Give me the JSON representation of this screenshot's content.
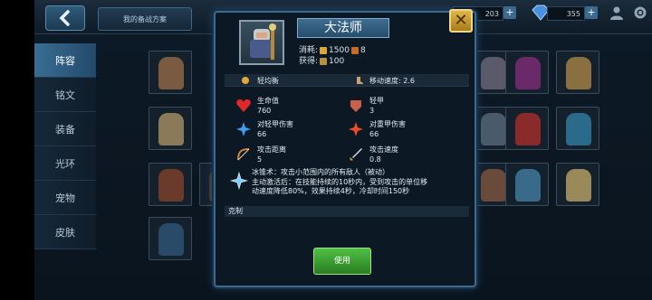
{
  "topbar": {
    "plan_label": "我的备战方案",
    "gold_value": "203",
    "gem_value": "355",
    "back_icon": "chevron-left-icon",
    "user_icon": "user-icon",
    "settings_icon": "gear-icon"
  },
  "tabs": [
    "阵容",
    "铭文",
    "装备",
    "光环",
    "宠物",
    "皮肤"
  ],
  "hero": {
    "name": "大法师",
    "cost_label": "消耗:",
    "cost_gold": "1500",
    "cost_other": "8",
    "gain_label": "获得:",
    "gain_value": "100"
  },
  "traits": {
    "type": "轻均衡",
    "move_speed": "移动速度: 2.6"
  },
  "stats": {
    "hp_label": "生命值",
    "hp_value": "760",
    "armor_label": "轻甲",
    "armor_value": "3",
    "light_dmg_label": "对轻甲伤害",
    "light_dmg_value": "66",
    "heavy_dmg_label": "对重甲伤害",
    "heavy_dmg_value": "66",
    "range_label": "攻击距离",
    "range_value": "5",
    "atk_speed_label": "攻击速度",
    "atk_speed_value": "0.8"
  },
  "skill": {
    "line1": "冰锥术：攻击小范围内的所有敌人（被动）",
    "line2": "主动激活后：在技能持续的10秒内，受到攻击的单位移",
    "line3": "动速度降低80%，效果持续4秒，冷却时间150秒"
  },
  "counter_label": "克制",
  "use_button": "使用",
  "colors": {
    "accent": "#3c6a8e",
    "gold": "#e0b64a",
    "use_green": "#3c9f33"
  }
}
